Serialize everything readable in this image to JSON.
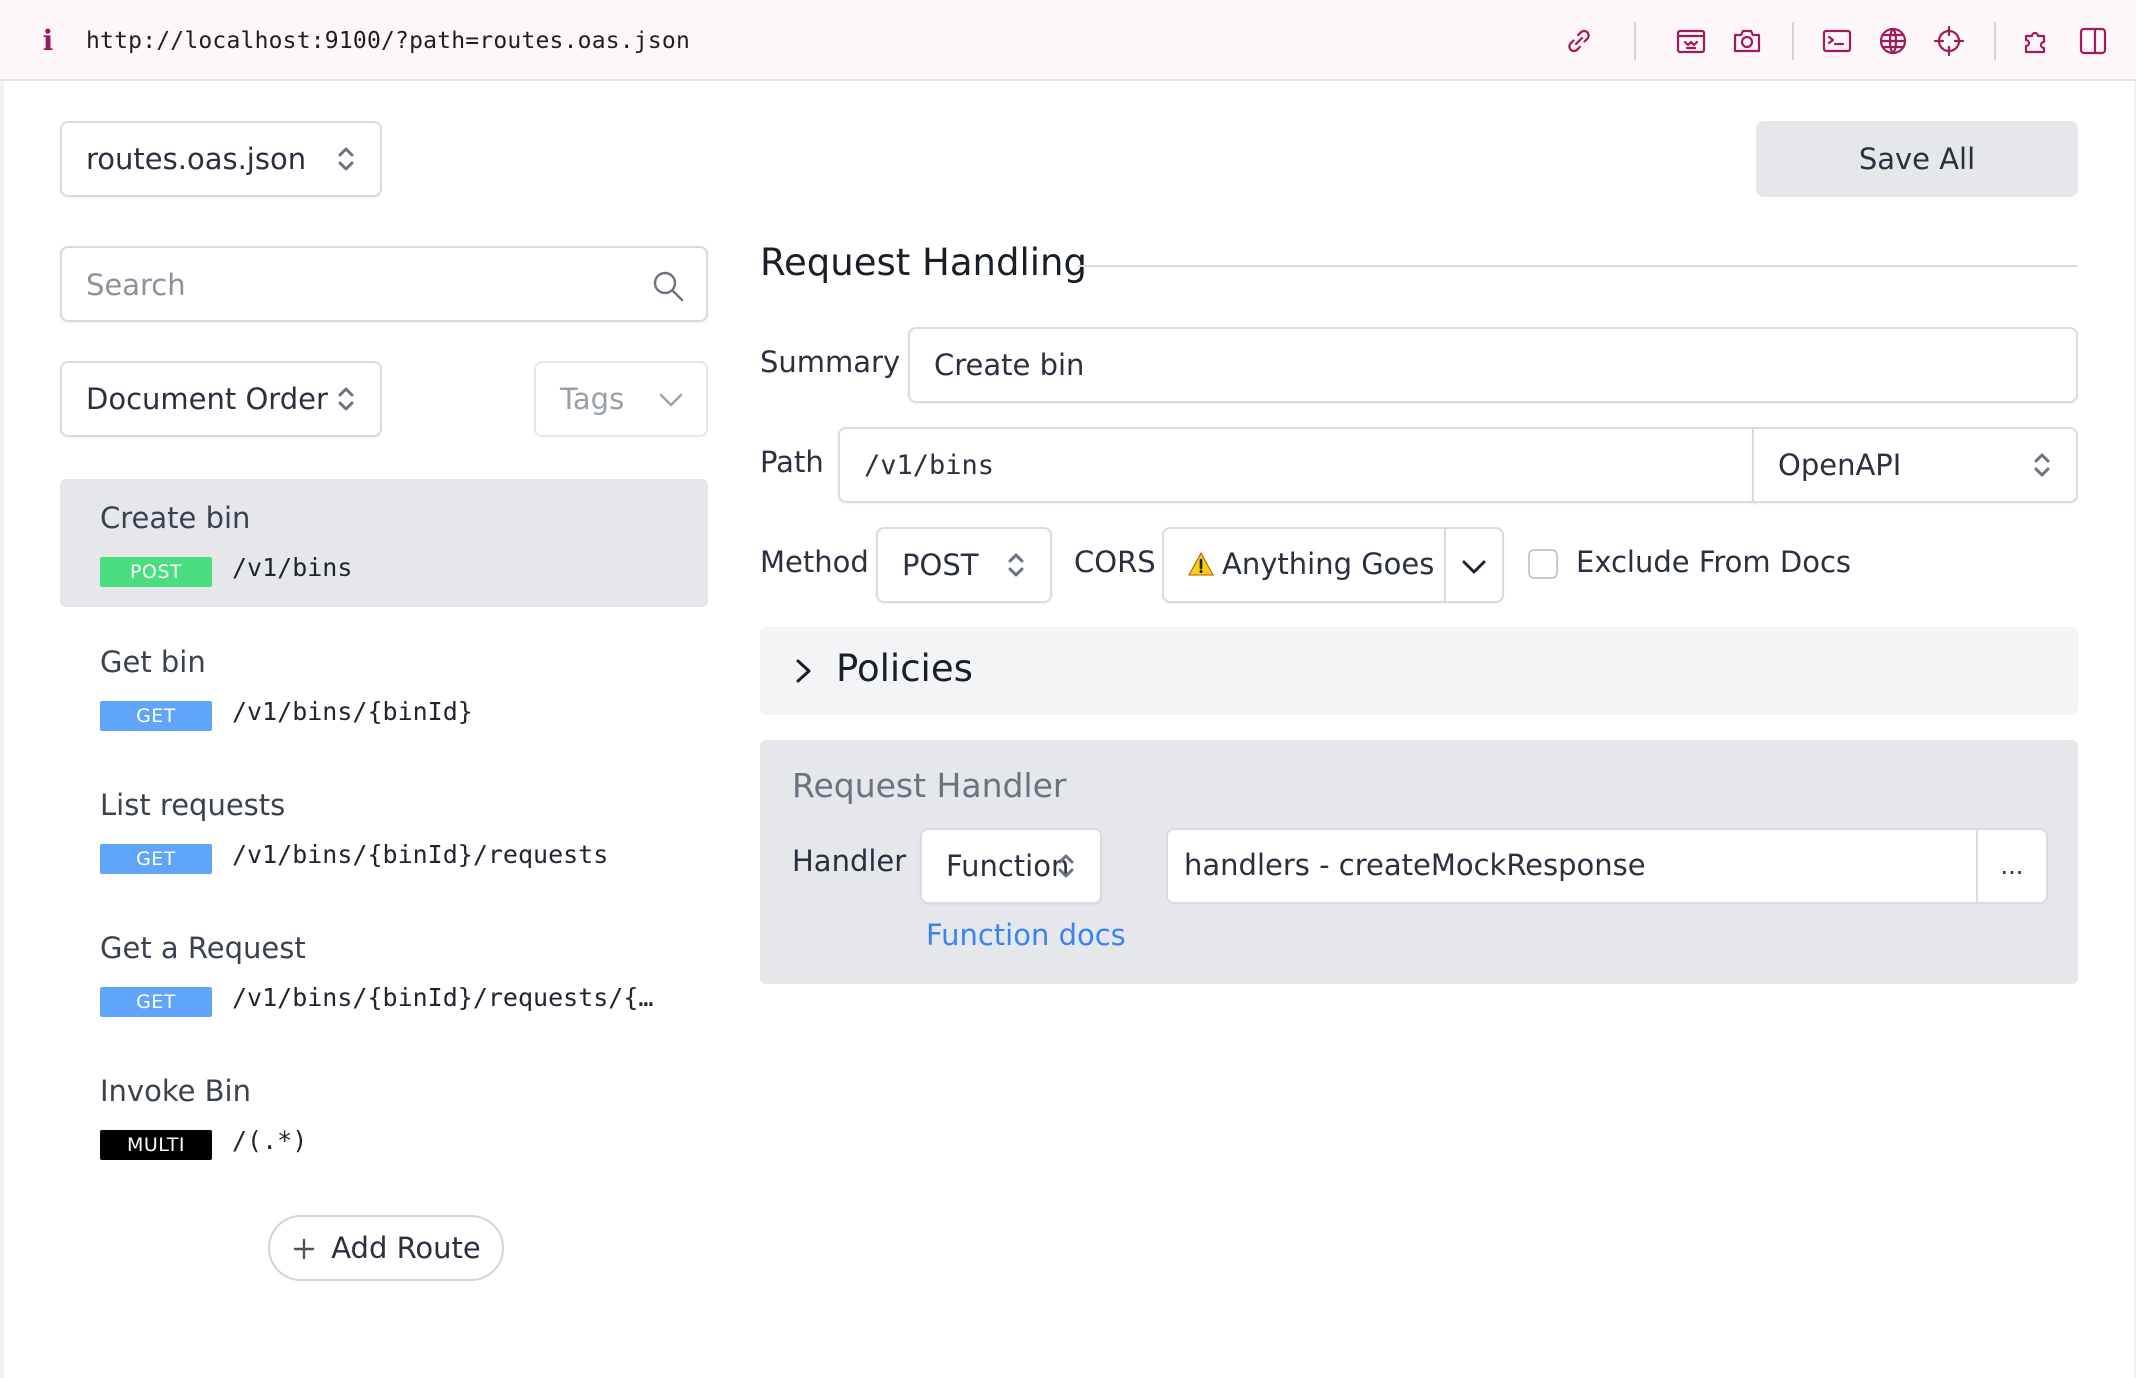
{
  "browser": {
    "url": "http://localhost:9100/?path=routes.oas.json",
    "info_glyph": "i",
    "icons": [
      "link-icon",
      "screenshot-area-icon",
      "camera-icon",
      "terminal-icon",
      "globe-icon",
      "crosshair-icon",
      "extension-puzzle-icon",
      "split-view-icon"
    ]
  },
  "file_select": {
    "value": "routes.oas.json"
  },
  "save_button": {
    "label": "Save All"
  },
  "search": {
    "placeholder": "Search"
  },
  "order_select": {
    "value": "Document Order"
  },
  "tags_select": {
    "value": "Tags"
  },
  "routes": [
    {
      "name": "Create bin",
      "method": "POST",
      "path": "/v1/bins",
      "badge_color": "#4ade80",
      "active": true
    },
    {
      "name": "Get bin",
      "method": "GET",
      "path": "/v1/bins/{binId}",
      "badge_color": "#60a5fa",
      "active": false
    },
    {
      "name": "List requests",
      "method": "GET",
      "path": "/v1/bins/{binId}/requests",
      "badge_color": "#60a5fa",
      "active": false
    },
    {
      "name": "Get a Request",
      "method": "GET",
      "path": "/v1/bins/{binId}/requests/{…",
      "badge_color": "#60a5fa",
      "active": false
    },
    {
      "name": "Invoke Bin",
      "method": "MULTI",
      "path": "/(.*)",
      "badge_color": "#000000",
      "active": false
    }
  ],
  "add_route": {
    "label": "Add Route"
  },
  "request_handling": {
    "title": "Request Handling",
    "summary_label": "Summary",
    "summary_value": "Create bin",
    "path_label": "Path",
    "path_value": "/v1/bins",
    "path_type": "OpenAPI",
    "method_label": "Method",
    "method_value": "POST",
    "cors_label": "CORS",
    "cors_value": "Anything Goes",
    "exclude_label": "Exclude From Docs"
  },
  "policies": {
    "title": "Policies"
  },
  "request_handler": {
    "title": "Request Handler",
    "handler_label": "Handler",
    "handler_type": "Function",
    "handler_value": "handlers - createMockResponse",
    "more_label": "...",
    "docs_link": "Function docs"
  },
  "colors": {
    "accent_toolbar": "#a3195b",
    "link": "#3b82f6",
    "post_badge": "#4ade80",
    "get_badge": "#60a5fa",
    "multi_badge": "#000000"
  }
}
